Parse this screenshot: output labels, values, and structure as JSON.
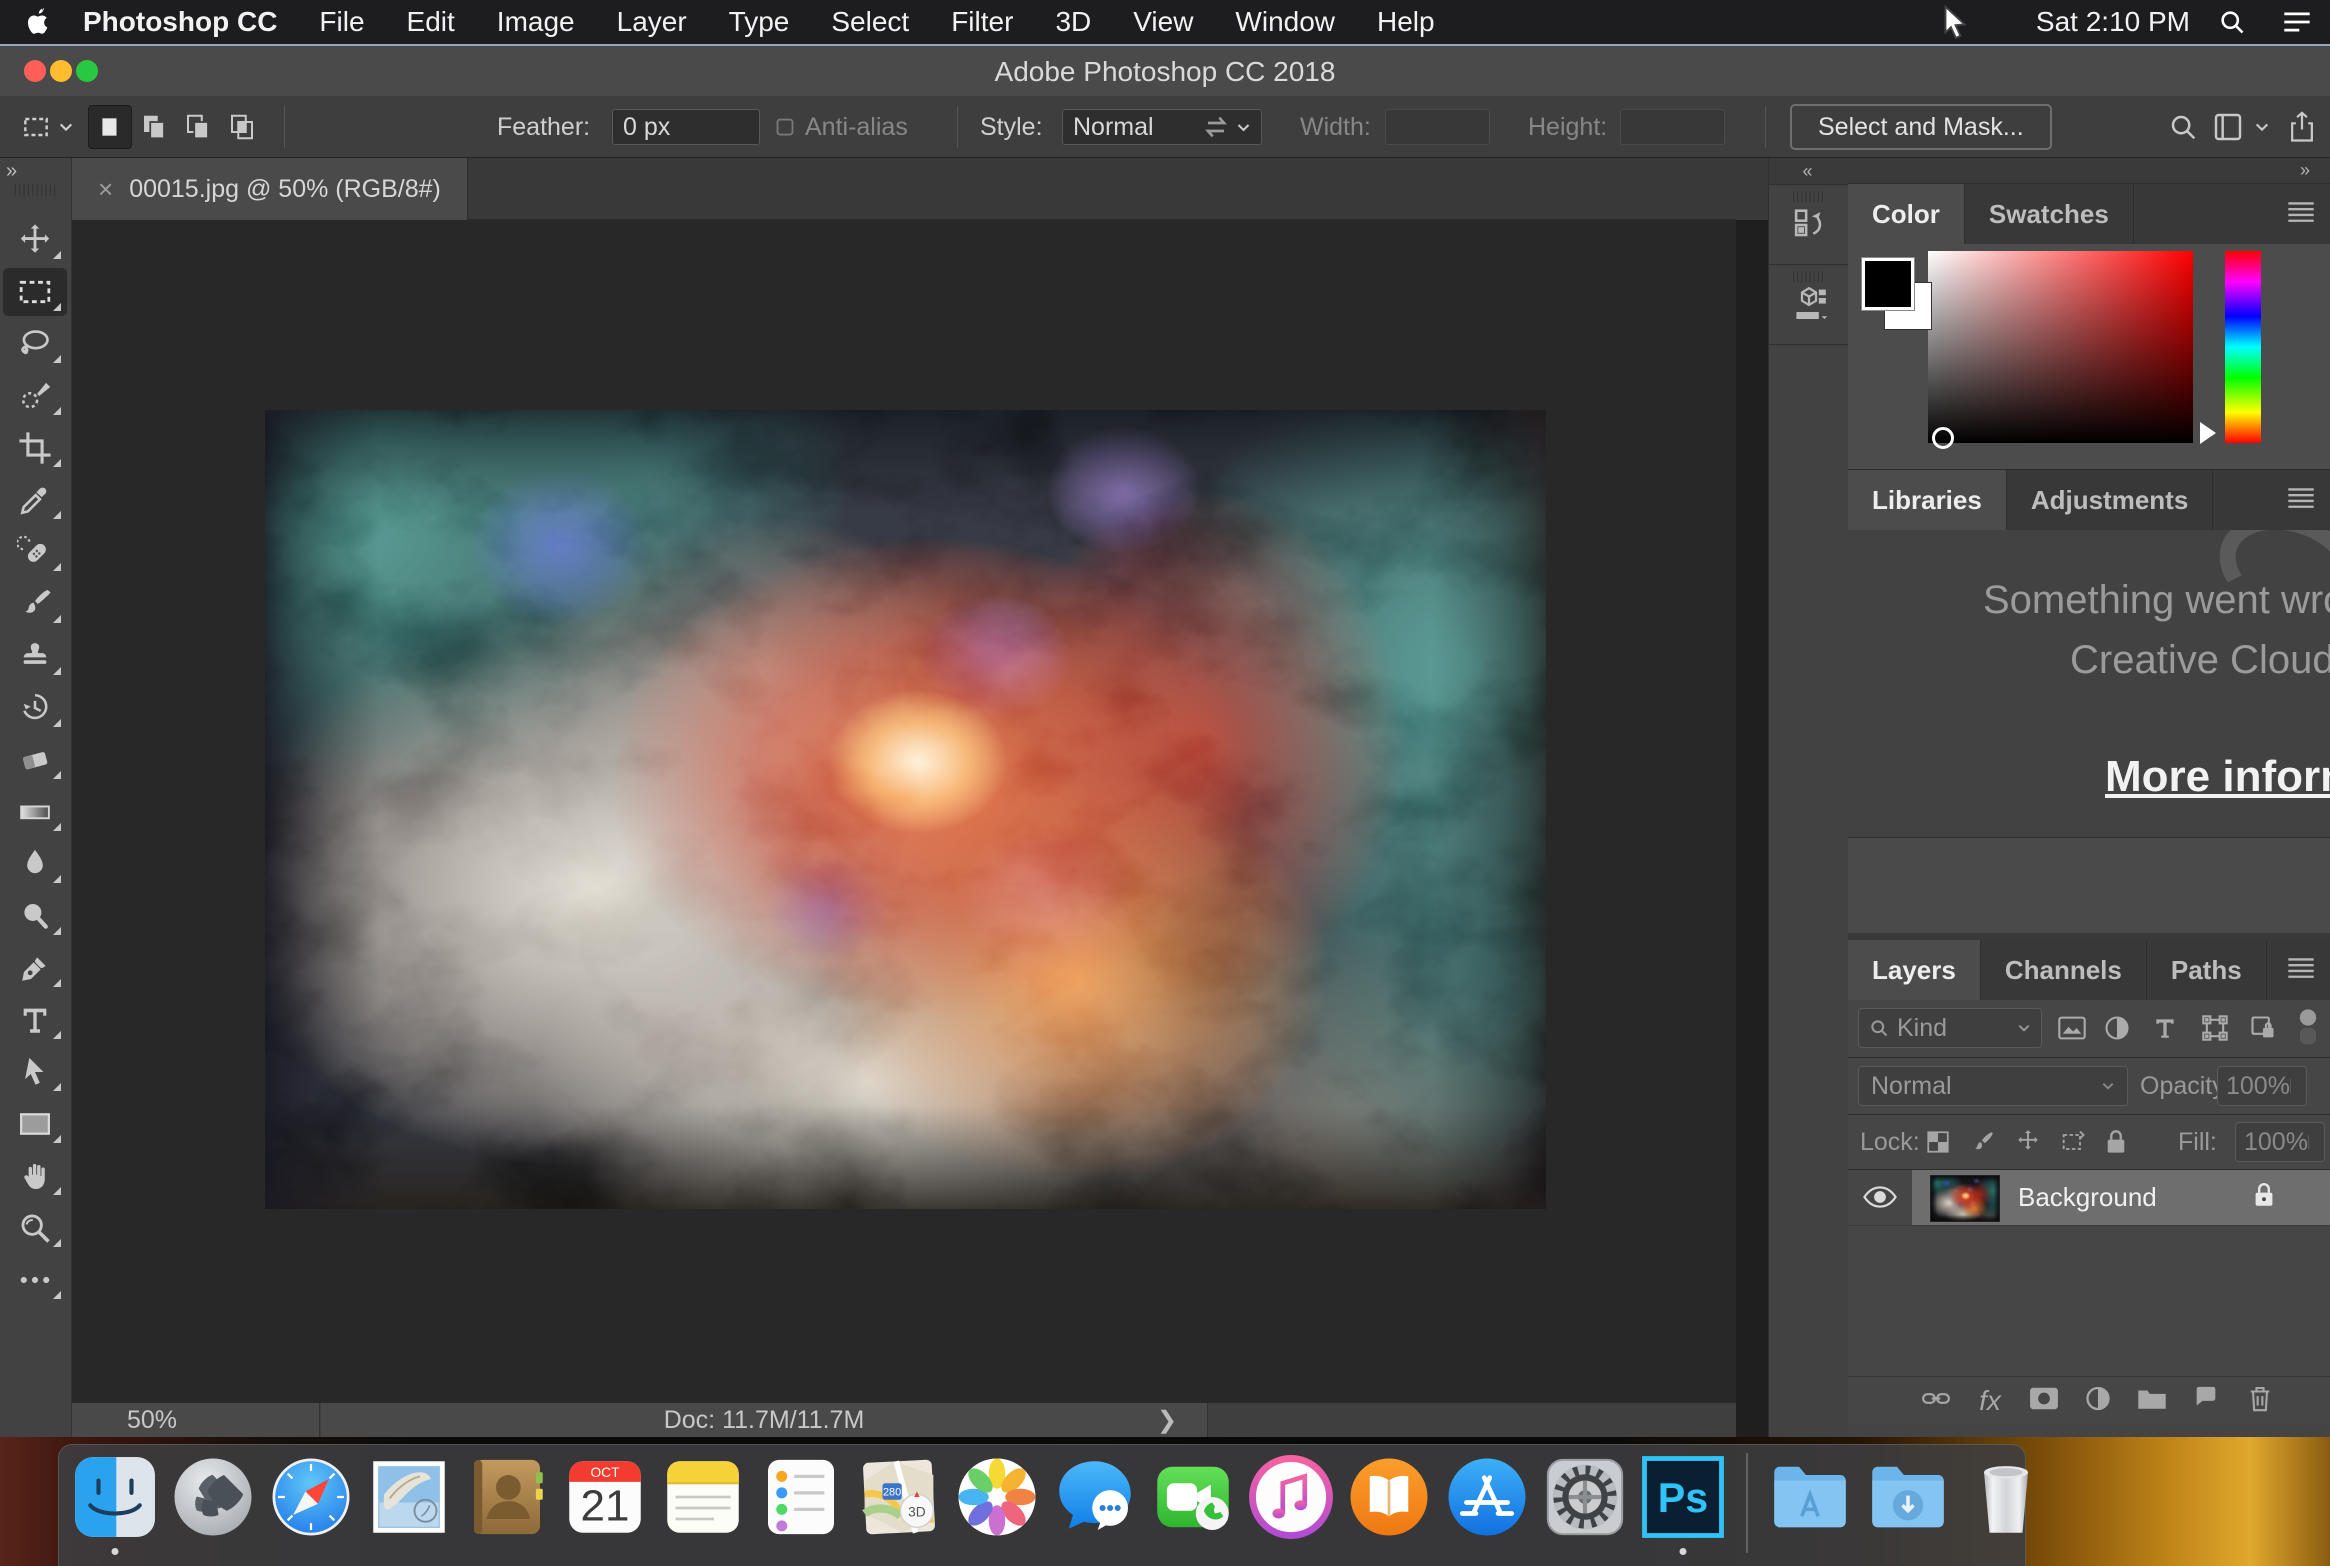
{
  "menubar": {
    "items": [
      {
        "label": "Photoshop CC",
        "bold": true
      },
      {
        "label": "File"
      },
      {
        "label": "Edit"
      },
      {
        "label": "Image"
      },
      {
        "label": "Layer"
      },
      {
        "label": "Type"
      },
      {
        "label": "Select"
      },
      {
        "label": "Filter"
      },
      {
        "label": "3D"
      },
      {
        "label": "View"
      },
      {
        "label": "Window"
      },
      {
        "label": "Help"
      }
    ],
    "clock": "Sat 2:10 PM"
  },
  "titlebar": {
    "title": "Adobe Photoshop CC 2018"
  },
  "optionsbar": {
    "feather_label": "Feather:",
    "feather_value": "0 px",
    "antialias_label": "Anti-alias",
    "style_label": "Style:",
    "style_value": "Normal",
    "width_label": "Width:",
    "height_label": "Height:",
    "select_mask_label": "Select and Mask..."
  },
  "toolbar": {
    "tools": [
      "move",
      "rectangular-marquee",
      "lasso",
      "quick-selection",
      "crop",
      "eyedropper",
      "spot-healing",
      "brush",
      "clone-stamp",
      "history-brush",
      "eraser",
      "gradient",
      "blur",
      "dodge",
      "pen",
      "type",
      "path-selection",
      "rectangle",
      "hand",
      "zoom",
      "ellipsis"
    ],
    "selected": "rectangular-marquee"
  },
  "document": {
    "tab_label": "00015.jpg @ 50% (RGB/8#)",
    "close_glyph": "×",
    "zoom": "50%",
    "doc_size": "Doc: 11.7M/11.7M"
  },
  "panels": {
    "color": {
      "tabs": [
        "Color",
        "Swatches"
      ],
      "active": "Color"
    },
    "libraries": {
      "tabs": [
        "Libraries",
        "Adjustments"
      ],
      "active": "Libraries",
      "message_line1": "Something went wrong",
      "message_line2": "Creative Cloud",
      "link": "More information"
    },
    "layers": {
      "tabs": [
        "Layers",
        "Channels",
        "Paths"
      ],
      "active": "Layers",
      "kind_label": "Kind",
      "blend_mode": "Normal",
      "opacity_label": "Opacity:",
      "opacity_value": "100%",
      "lock_label": "Lock:",
      "fill_label": "Fill:",
      "layer_name": "Background"
    }
  },
  "dock": {
    "apps": [
      {
        "id": "finder",
        "name": "Finder",
        "running": true
      },
      {
        "id": "launchpad",
        "name": "Launchpad"
      },
      {
        "id": "safari",
        "name": "Safari"
      },
      {
        "id": "mail",
        "name": "Mail"
      },
      {
        "id": "contacts",
        "name": "Contacts"
      },
      {
        "id": "calendar",
        "name": "Calendar"
      },
      {
        "id": "notes",
        "name": "Notes"
      },
      {
        "id": "reminders",
        "name": "Reminders"
      },
      {
        "id": "maps",
        "name": "Maps"
      },
      {
        "id": "photos",
        "name": "Photos"
      },
      {
        "id": "messages",
        "name": "Messages"
      },
      {
        "id": "facetime",
        "name": "FaceTime"
      },
      {
        "id": "itunes",
        "name": "iTunes"
      },
      {
        "id": "books",
        "name": "Books"
      },
      {
        "id": "appstore",
        "name": "App Store"
      },
      {
        "id": "sysprefs",
        "name": "System Preferences"
      },
      {
        "id": "photoshop",
        "name": "Photoshop",
        "running": true
      },
      {
        "id": "sep",
        "name": "separator"
      },
      {
        "id": "folder-apps",
        "name": "Applications Folder"
      },
      {
        "id": "folder-downloads",
        "name": "Downloads Folder"
      },
      {
        "id": "trash",
        "name": "Trash"
      }
    ],
    "calendar_month": "OCT",
    "calendar_day": "21",
    "maps_badge": "3D",
    "photoshop_label": "Ps"
  }
}
